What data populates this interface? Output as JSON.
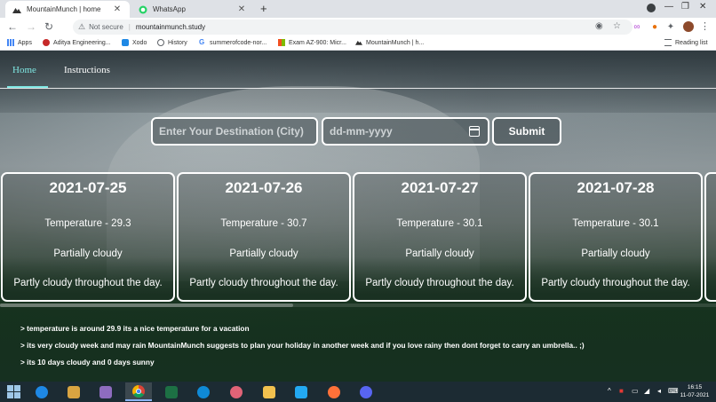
{
  "browser": {
    "tabs": [
      {
        "title": "MountainMunch | home",
        "active": true
      },
      {
        "title": "WhatsApp",
        "active": false
      }
    ],
    "address": {
      "security_label": "Not secure",
      "url": "mountainmunch.study"
    },
    "bookmarks": [
      {
        "label": "Apps",
        "icon": "apps-grid-icon"
      },
      {
        "label": "Aditya Engineering...",
        "icon": "aditya-logo-icon"
      },
      {
        "label": "Xodo",
        "icon": "xodo-icon"
      },
      {
        "label": "History",
        "icon": "history-icon"
      },
      {
        "label": "summerofcode-nor...",
        "icon": "google-g-icon"
      },
      {
        "label": "Exam AZ-900: Micr...",
        "icon": "microsoft-icon"
      },
      {
        "label": "MountainMunch | h...",
        "icon": "mountainmunch-icon"
      }
    ],
    "reading_list_label": "Reading list"
  },
  "nav": {
    "home_label": "Home",
    "instructions_label": "Instructions",
    "accent_color": "#7fe7e2"
  },
  "form": {
    "destination_placeholder": "Enter Your Destination (City)",
    "date_placeholder": "dd-mm-yyyy",
    "submit_label": "Submit"
  },
  "forecast": [
    {
      "date": "2021-07-25",
      "temperature": "Temperature - 29.3",
      "condition": "Partially cloudy",
      "description": "Partly cloudy throughout the day."
    },
    {
      "date": "2021-07-26",
      "temperature": "Temperature - 30.7",
      "condition": "Partially cloudy",
      "description": "Partly cloudy throughout the day."
    },
    {
      "date": "2021-07-27",
      "temperature": "Temperature - 30.1",
      "condition": "Partially cloudy",
      "description": "Partly cloudy throughout the day."
    },
    {
      "date": "2021-07-28",
      "temperature": "Temperature - 30.1",
      "condition": "Partially cloudy",
      "description": "Partly cloudy throughout the day."
    }
  ],
  "notes": [
    "> temperature is around 29.9 its a nice temperature for a vacation",
    "> its very cloudy week and may rain MountainMunch suggests to plan your holiday in another week and if you love rainy then dont forget to carry an umbrella.. ;)",
    "> its 10 days cloudy and 0 days sunny"
  ],
  "taskbar": {
    "time": "16:15",
    "date": "11-07-2021"
  }
}
